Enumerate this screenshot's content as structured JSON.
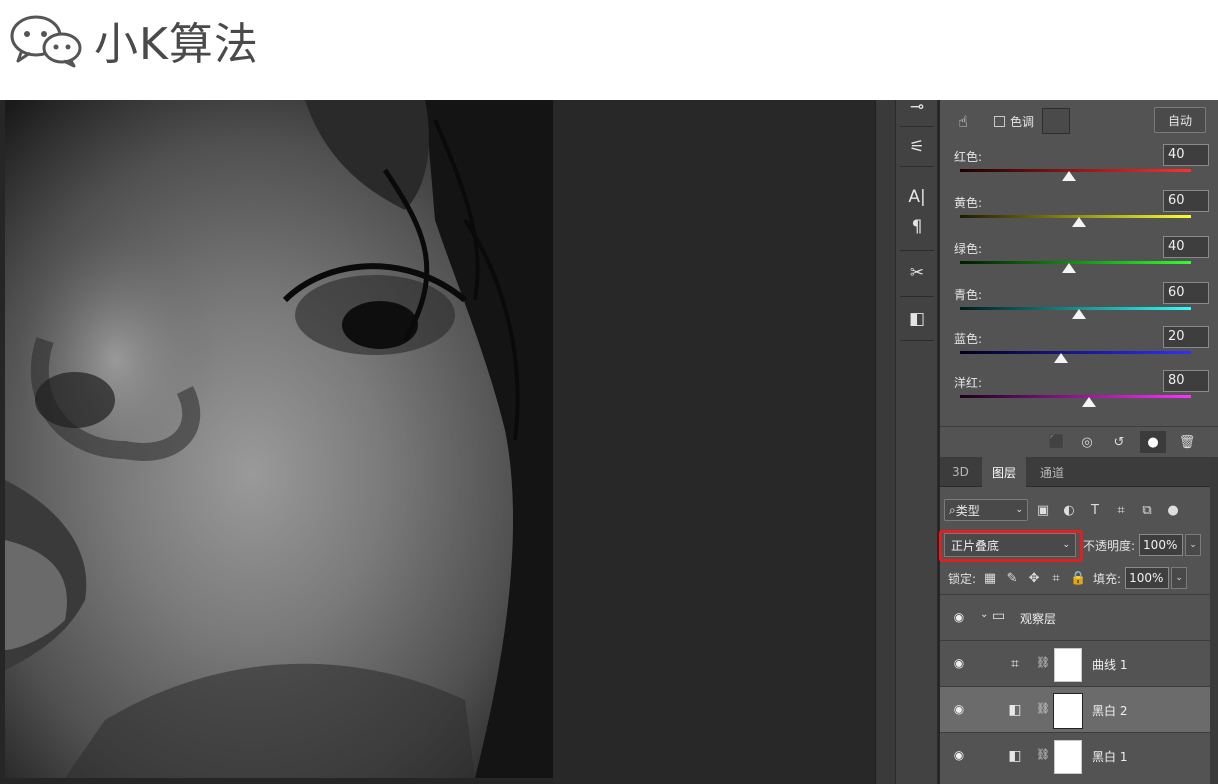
{
  "brand": {
    "text": "小K算法",
    "icon": "wechat-icon"
  },
  "toolbar": {
    "items": [
      {
        "name": "brush-arrow-tool-icon",
        "glyph": "⊸"
      },
      {
        "name": "clone-stamp-icon",
        "glyph": "⚟"
      },
      {
        "name": "character-panel-icon",
        "glyph": "A|"
      },
      {
        "name": "paragraph-panel-icon",
        "glyph": "¶"
      },
      {
        "name": "tool-presets-icon",
        "glyph": "✂"
      },
      {
        "name": "properties-panel-icon",
        "glyph": "◧"
      }
    ]
  },
  "properties": {
    "tint_label": "色调",
    "auto_label": "自动",
    "sliders": [
      {
        "label": "红色:",
        "value": "40",
        "grad": "linear-gradient(90deg,#1b0000,#ff3030)"
      },
      {
        "label": "黄色:",
        "value": "60",
        "grad": "linear-gradient(90deg,#1b1b00,#ffff30)"
      },
      {
        "label": "绿色:",
        "value": "40",
        "grad": "linear-gradient(90deg,#001b00,#30ff30)"
      },
      {
        "label": "青色:",
        "value": "60",
        "grad": "linear-gradient(90deg,#001b1b,#30ffff)"
      },
      {
        "label": "蓝色:",
        "value": "20",
        "grad": "linear-gradient(90deg,#00001b,#3030ff)"
      },
      {
        "label": "洋红:",
        "value": "80",
        "grad": "linear-gradient(90deg,#1b001b,#ff30ff)"
      }
    ],
    "bottom_icons": [
      "clip-to-layer-icon",
      "view-previous-icon",
      "reset-icon",
      "visibility-icon",
      "trash-icon"
    ]
  },
  "layers_panel": {
    "tabs": [
      "3D",
      "图层",
      "通道"
    ],
    "active_tab": "图层",
    "filter_label": "类型",
    "blend_mode": "正片叠底",
    "opacity_label": "不透明度:",
    "opacity_value": "100%",
    "lock_label": "锁定:",
    "fill_label": "填充:",
    "fill_value": "100%",
    "layers": [
      {
        "name": "观察层",
        "type": "group"
      },
      {
        "name": "曲线 1",
        "type": "curves"
      },
      {
        "name": "黑白 2",
        "type": "blackwhite",
        "selected": true
      },
      {
        "name": "黑白 1",
        "type": "blackwhite"
      }
    ]
  },
  "colors": {
    "highlight": "#e02020",
    "panel": "#535353"
  }
}
